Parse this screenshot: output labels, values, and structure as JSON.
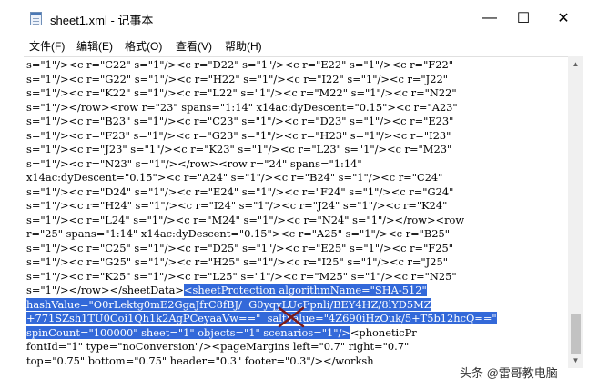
{
  "window": {
    "title": "sheet1.xml - 记事本",
    "minimize_glyph": "—",
    "maximize_glyph": "☐",
    "close_glyph": "✕"
  },
  "menu": [
    {
      "label": "文件(F)"
    },
    {
      "label": "编辑(E)"
    },
    {
      "label": "格式(O)"
    },
    {
      "label": "查看(V)"
    },
    {
      "label": "帮助(H)"
    }
  ],
  "editor": {
    "lines": [
      {
        "text": "s=\"1\"/><c r=\"C22\" s=\"1\"/><c r=\"D22\" s=\"1\"/><c r=\"E22\" s=\"1\"/><c r=\"F22\"",
        "sel": ""
      },
      {
        "text": "s=\"1\"/><c r=\"G22\" s=\"1\"/><c r=\"H22\" s=\"1\"/><c r=\"I22\" s=\"1\"/><c r=\"J22\"",
        "sel": ""
      },
      {
        "text": "s=\"1\"/><c r=\"K22\" s=\"1\"/><c r=\"L22\" s=\"1\"/><c r=\"M22\" s=\"1\"/><c r=\"N22\"",
        "sel": ""
      },
      {
        "text": "s=\"1\"/></row><row r=\"23\" spans=\"1:14\" x14ac:dyDescent=\"0.15\"><c r=\"A23\"",
        "sel": ""
      },
      {
        "text": "s=\"1\"/><c r=\"B23\" s=\"1\"/><c r=\"C23\" s=\"1\"/><c r=\"D23\" s=\"1\"/><c r=\"E23\"",
        "sel": ""
      },
      {
        "text": "s=\"1\"/><c r=\"F23\" s=\"1\"/><c r=\"G23\" s=\"1\"/><c r=\"H23\" s=\"1\"/><c r=\"I23\"",
        "sel": ""
      },
      {
        "text": "s=\"1\"/><c r=\"J23\" s=\"1\"/><c r=\"K23\" s=\"1\"/><c r=\"L23\" s=\"1\"/><c r=\"M23\"",
        "sel": ""
      },
      {
        "text": "s=\"1\"/><c r=\"N23\" s=\"1\"/></row><row r=\"24\" spans=\"1:14\"",
        "sel": ""
      },
      {
        "text": "x14ac:dyDescent=\"0.15\"><c r=\"A24\" s=\"1\"/><c r=\"B24\" s=\"1\"/><c r=\"C24\"",
        "sel": ""
      },
      {
        "text": "s=\"1\"/><c r=\"D24\" s=\"1\"/><c r=\"E24\" s=\"1\"/><c r=\"F24\" s=\"1\"/><c r=\"G24\"",
        "sel": ""
      },
      {
        "text": "s=\"1\"/><c r=\"H24\" s=\"1\"/><c r=\"I24\" s=\"1\"/><c r=\"J24\" s=\"1\"/><c r=\"K24\"",
        "sel": ""
      },
      {
        "text": "s=\"1\"/><c r=\"L24\" s=\"1\"/><c r=\"M24\" s=\"1\"/><c r=\"N24\" s=\"1\"/></row><row",
        "sel": ""
      },
      {
        "text": "r=\"25\" spans=\"1:14\" x14ac:dyDescent=\"0.15\"><c r=\"A25\" s=\"1\"/><c r=\"B25\"",
        "sel": ""
      },
      {
        "text": "s=\"1\"/><c r=\"C25\" s=\"1\"/><c r=\"D25\" s=\"1\"/><c r=\"E25\" s=\"1\"/><c r=\"F25\"",
        "sel": ""
      },
      {
        "text": "s=\"1\"/><c r=\"G25\" s=\"1\"/><c r=\"H25\" s=\"1\"/><c r=\"I25\" s=\"1\"/><c r=\"J25\"",
        "sel": ""
      },
      {
        "text": "s=\"1\"/><c r=\"K25\" s=\"1\"/><c r=\"L25\" s=\"1\"/><c r=\"M25\" s=\"1\"/><c r=\"N25\"",
        "sel": ""
      },
      {
        "text": "s=\"1\"/></row></sheetData>",
        "sel": "<sheetProtection algorithmName=\"SHA-512\""
      },
      {
        "text": "",
        "sel": "hashValue=\"O0rLektg0mE2GgaJfrC8fBJ/  G0yqyLUcFpnli/BEY4HZ/8lYD5MZ"
      },
      {
        "text": "",
        "sel": "+771SZsh1TU0Coi1Qh1k2AgPCeyaaVw==\"  saltValue=\"4Z690iHzOuk/5+T5b12hcQ==\""
      },
      {
        "text": "",
        "sel": "spinCount=\"100000\" sheet=\"1\" objects=\"1\" scenarios=\"1\"/>",
        "after": "<phoneticPr"
      },
      {
        "text": "fontId=\"1\" type=\"noConversion\"/><pageMargins left=\"0.7\" right=\"0.7\"",
        "sel": ""
      },
      {
        "text": "top=\"0.75\" bottom=\"0.75\" header=\"0.3\" footer=\"0.3\"/></worksh",
        "sel": ""
      }
    ]
  },
  "watermark": "头条 @雷哥教电脑"
}
